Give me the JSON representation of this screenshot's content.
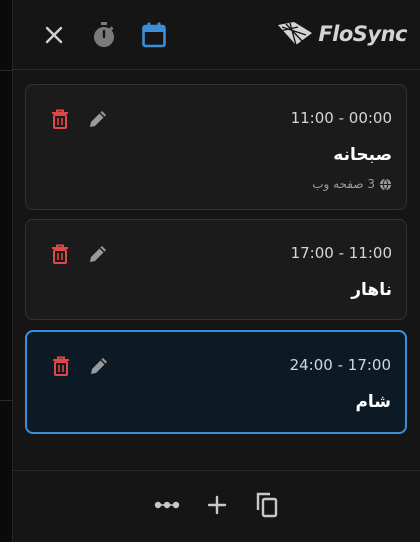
{
  "header": {
    "close_icon": "close-icon",
    "timer_icon": "stopwatch-icon",
    "calendar_icon": "calendar-icon",
    "logo_text": "FloSync",
    "accent": "#3b8fd9"
  },
  "items": [
    {
      "time": "11:00 - 00:00",
      "title": "صبحانه",
      "pages": "3 صفحه وب",
      "selected": false
    },
    {
      "time": "17:00 - 11:00",
      "title": "ناهار",
      "selected": false
    },
    {
      "time": "24:00 - 17:00",
      "title": "شام",
      "selected": true
    }
  ],
  "colors": {
    "delete": "#e04848",
    "edit": "#9a9a9a",
    "selected_border": "#3b8fd9"
  },
  "footer": {
    "more_icon": "more-dots-icon",
    "add_icon": "plus-icon",
    "copy_icon": "copy-icon"
  }
}
